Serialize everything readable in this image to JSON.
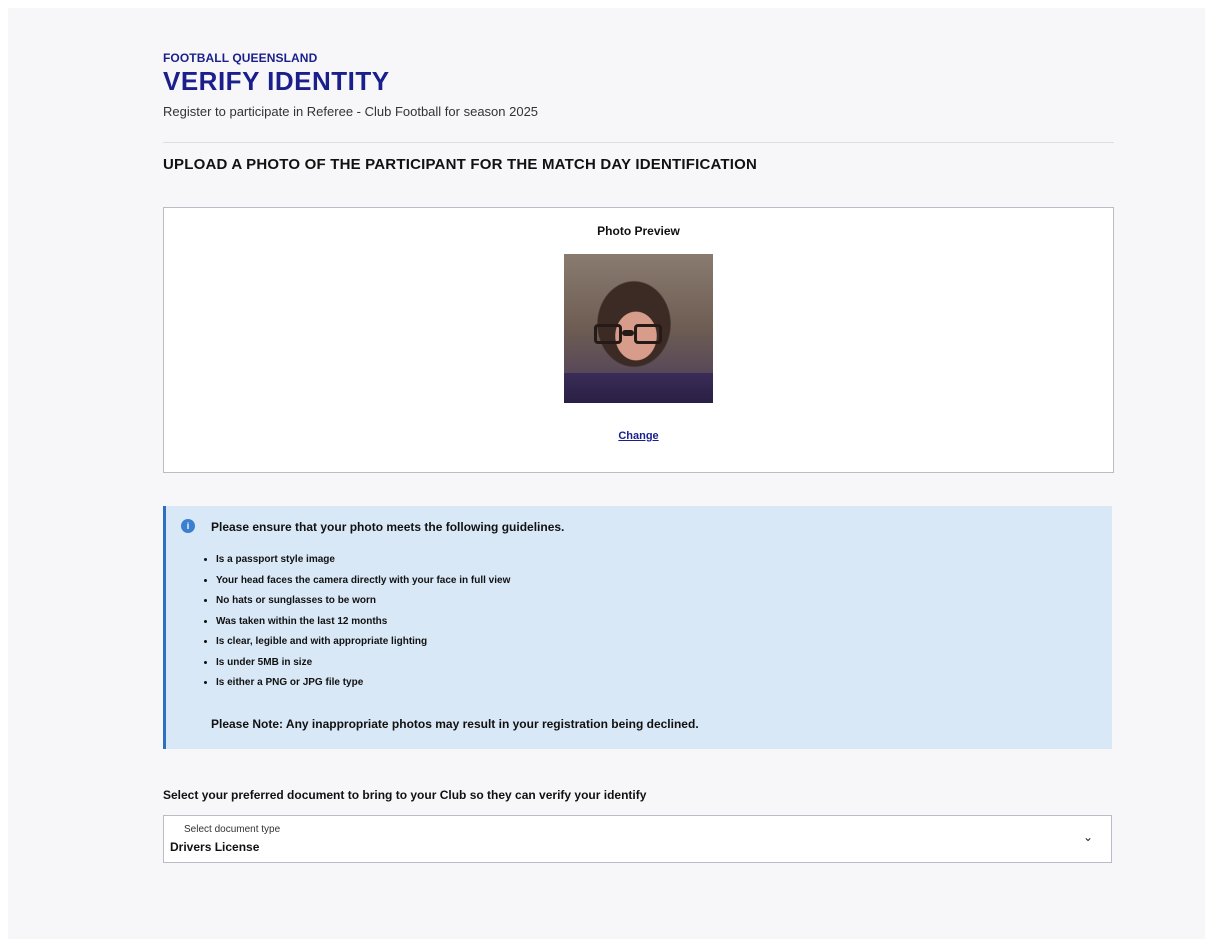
{
  "header": {
    "org": "FOOTBALL QUEENSLAND",
    "title": "VERIFY IDENTITY",
    "subtitle": "Register to participate in Referee - Club Football for season 2025"
  },
  "section": {
    "heading": "UPLOAD A PHOTO OF THE PARTICIPANT FOR THE MATCH DAY IDENTIFICATION"
  },
  "photo": {
    "label": "Photo Preview",
    "change_label": "Change"
  },
  "guidelines": {
    "icon": "info-icon",
    "heading": "Please ensure that your photo meets the following guidelines.",
    "items": [
      "Is a passport style image",
      "Your head faces the camera directly with your face in full view",
      "No hats or sunglasses to be worn",
      "Was taken within the last 12 months",
      "Is clear, legible and with appropriate lighting",
      "Is under 5MB in size",
      "Is either a PNG or JPG file type"
    ],
    "note": "Please Note: Any inappropriate photos may result in your registration being declined."
  },
  "document": {
    "label": "Select your preferred document to bring to your Club so they can verify your identify",
    "select_caption": "Select document type",
    "selected_value": "Drivers License",
    "icon": "chevron-down-icon"
  },
  "colors": {
    "brand": "#1a1f8c",
    "info_bg": "#d9e8f7",
    "info_border": "#2f6fbf",
    "page_bg": "#f7f7f9"
  }
}
